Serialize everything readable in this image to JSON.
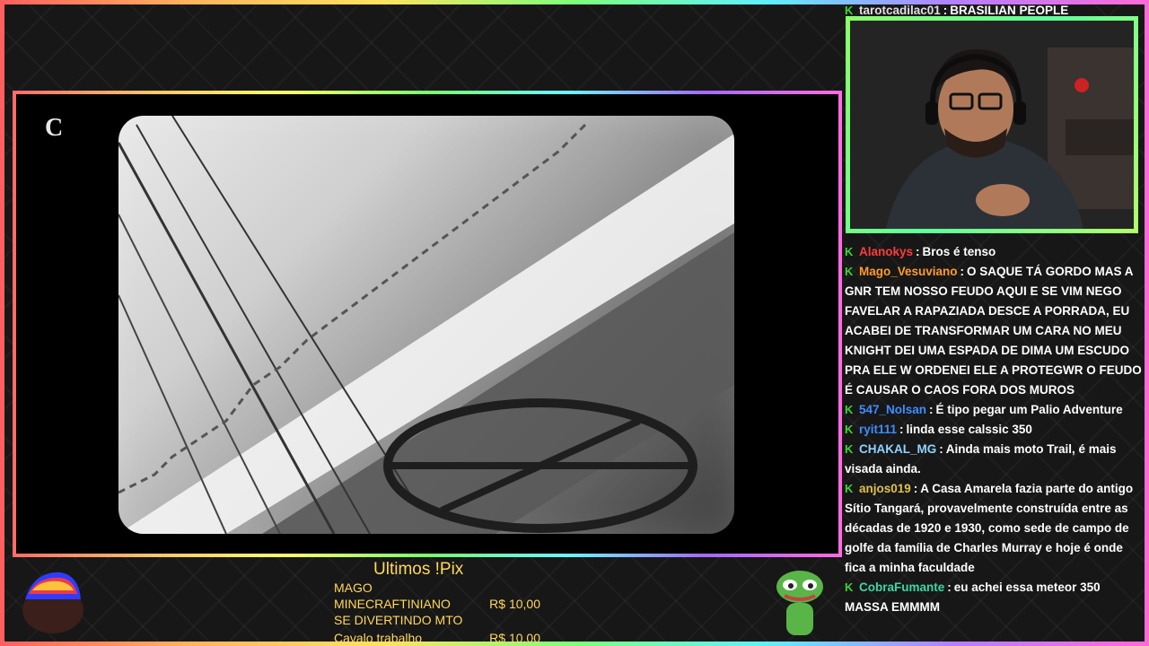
{
  "stream": {
    "video_logo": "C",
    "pix_title": "Ultimos !Pix",
    "pix": [
      {
        "line1": "MAGO",
        "line2": "MINECRAFTINIANO",
        "amount": "R$ 10,00",
        "line3": "SE DIVERTINDO MTO"
      },
      {
        "line1": "Cavalo trabalho",
        "amount": "R$ 10,00"
      }
    ]
  },
  "chat": {
    "top": {
      "user": "tarotcadilac01",
      "text": "BRASILIAN PEOPLE"
    },
    "messages": [
      {
        "user": "Alanokys",
        "color": "#ff3b3b",
        "text": "Bros é tenso"
      },
      {
        "user": "Mago_Vesuviano",
        "color": "#ff9b2f",
        "text": "O SAQUE TÁ GORDO MAS A GNR TEM NOSSO FEUDO AQUI E SE VIM NEGO FAVELAR A RAPAZIADA DESCE A PORRADA, EU ACABEI DE TRANSFORMAR UM CARA NO MEU KNIGHT DEI UMA ESPADA DE DIMA UM ESCUDO PRA ELE W ORDENEI ELE A PROTEGWR O FEUDO É CAUSAR O CAOS FORA DOS MUROS"
      },
      {
        "user": "547_Nolsan",
        "color": "#3d8dff",
        "text": "É tipo pegar um Palio Adventure"
      },
      {
        "user": "ryit111",
        "color": "#3d8dff",
        "text": "linda esse calssic 350"
      },
      {
        "user": "CHAKAL_MG",
        "color": "#8fd3ff",
        "text": "Ainda mais moto Trail, é mais visada ainda."
      },
      {
        "user": "anjos019",
        "color": "#e0c14a",
        "text": "A Casa Amarela fazia parte do antigo Sítio Tangará, provavelmente construída entre as décadas de 1920 e 1930, como sede de campo de golfe da família de Charles Murray e hoje é onde fica a minha faculdade"
      },
      {
        "user": "CobraFumante",
        "color": "#3dd6a6",
        "text": "eu achei essa meteor 350 MASSA EMMMM"
      }
    ]
  },
  "colors": {
    "badge_green": "#3dd62f",
    "pix_yellow": "#ffd85b"
  }
}
